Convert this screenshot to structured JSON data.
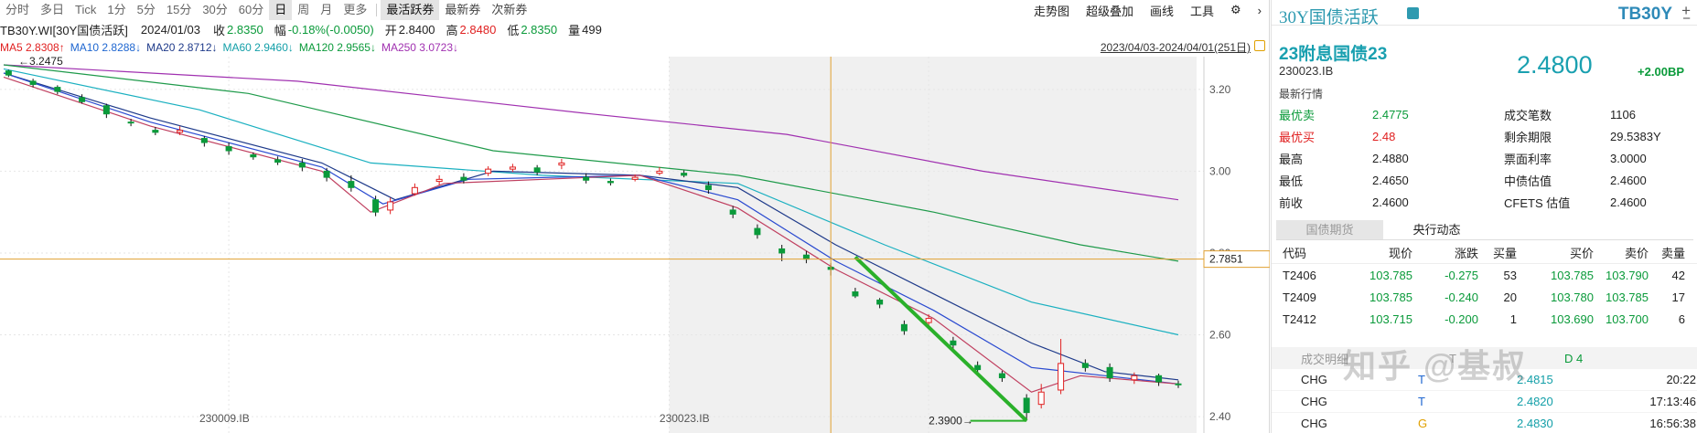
{
  "toolbar": {
    "periods": [
      "分时",
      "多日",
      "Tick",
      "1分",
      "5分",
      "15分",
      "30分",
      "60分",
      "日",
      "周",
      "月",
      "更多"
    ],
    "active_period": "日",
    "bonds": [
      "最活跃券",
      "最新券",
      "次新券"
    ],
    "active_bond": "最活跃券",
    "tools": [
      "走势图",
      "超级叠加",
      "画线",
      "工具"
    ]
  },
  "info": {
    "symbol": "TB30Y.WI[30Y国债活跃]",
    "date": "2024/01/03",
    "close_label": "收",
    "close": "2.8350",
    "amp_label": "幅",
    "amp": "-0.18%(-0.0050)",
    "open_label": "开",
    "open": "2.8400",
    "high_label": "高",
    "high": "2.8480",
    "low_label": "低",
    "low": "2.8350",
    "vol_label": "量",
    "vol": "499"
  },
  "ma": {
    "ma5": "MA5 2.8308↑",
    "ma10": "MA10 2.8288↓",
    "ma20": "MA20 2.8712↓",
    "ma60": "MA60 2.9460↓",
    "ma120": "MA120 2.9565↓",
    "ma250": "MA250 3.0723↓",
    "range": "2023/04/03-2024/04/01(251日)"
  },
  "chart_data": {
    "type": "candlestick",
    "y_ticks": [
      "3.20",
      "3.00",
      "2.80",
      "2.60",
      "2.40"
    ],
    "ylim": [
      2.36,
      3.28
    ],
    "price_line": "2.7851",
    "annotations": {
      "start_high": "3.2475",
      "low": "2.3900"
    },
    "x_labels": [
      "230009.IB",
      "230023.IB"
    ],
    "close_path": [
      [
        0,
        3.24
      ],
      [
        10,
        3.22
      ],
      [
        20,
        3.2
      ],
      [
        30,
        3.18
      ],
      [
        40,
        3.16
      ],
      [
        50,
        3.12
      ],
      [
        60,
        3.1
      ],
      [
        70,
        3.1
      ],
      [
        80,
        3.08
      ],
      [
        90,
        3.06
      ],
      [
        100,
        3.04
      ],
      [
        110,
        3.03
      ],
      [
        120,
        3.02
      ],
      [
        130,
        3.0
      ],
      [
        140,
        2.98
      ],
      [
        150,
        2.9
      ],
      [
        160,
        2.91
      ],
      [
        170,
        2.96
      ],
      [
        180,
        2.98
      ],
      [
        190,
        2.98
      ],
      [
        200,
        3.0
      ],
      [
        210,
        3.01
      ],
      [
        220,
        3.0
      ],
      [
        230,
        3.02
      ],
      [
        240,
        2.98
      ],
      [
        250,
        2.97
      ],
      [
        260,
        2.98
      ],
      [
        270,
        3.0
      ],
      [
        280,
        2.99
      ],
      [
        290,
        2.96
      ],
      [
        300,
        2.9
      ],
      [
        310,
        2.85
      ],
      [
        320,
        2.8
      ],
      [
        330,
        2.79
      ],
      [
        340,
        2.76
      ],
      [
        350,
        2.7
      ],
      [
        360,
        2.68
      ],
      [
        370,
        2.62
      ],
      [
        380,
        2.63
      ],
      [
        390,
        2.58
      ],
      [
        400,
        2.52
      ],
      [
        410,
        2.5
      ],
      [
        420,
        2.44
      ],
      [
        430,
        2.46
      ],
      [
        440,
        2.53
      ],
      [
        450,
        2.52
      ],
      [
        460,
        2.49
      ],
      [
        470,
        2.5
      ],
      [
        480,
        2.48
      ]
    ],
    "series": [
      {
        "name": "MA250",
        "color": "#a030b0",
        "points": [
          [
            0,
            3.26
          ],
          [
            120,
            3.22
          ],
          [
            240,
            3.14
          ],
          [
            320,
            3.09
          ],
          [
            400,
            3.0
          ],
          [
            480,
            2.93
          ]
        ]
      },
      {
        "name": "MA120",
        "color": "#1e9a4a",
        "points": [
          [
            0,
            3.26
          ],
          [
            100,
            3.19
          ],
          [
            200,
            3.05
          ],
          [
            300,
            2.99
          ],
          [
            380,
            2.9
          ],
          [
            440,
            2.82
          ],
          [
            480,
            2.78
          ]
        ]
      },
      {
        "name": "MA60",
        "color": "#1ab0c0",
        "points": [
          [
            0,
            3.25
          ],
          [
            80,
            3.15
          ],
          [
            150,
            3.02
          ],
          [
            220,
            2.99
          ],
          [
            300,
            2.97
          ],
          [
            360,
            2.82
          ],
          [
            420,
            2.68
          ],
          [
            480,
            2.6
          ]
        ]
      },
      {
        "name": "MA20",
        "color": "#1e3a8a",
        "points": [
          [
            0,
            3.24
          ],
          [
            60,
            3.13
          ],
          [
            130,
            3.02
          ],
          [
            160,
            2.93
          ],
          [
            200,
            3.0
          ],
          [
            260,
            2.99
          ],
          [
            300,
            2.96
          ],
          [
            340,
            2.82
          ],
          [
            380,
            2.7
          ],
          [
            420,
            2.58
          ],
          [
            450,
            2.51
          ],
          [
            480,
            2.49
          ]
        ]
      },
      {
        "name": "MA10",
        "color": "#2a4ad0",
        "points": [
          [
            0,
            3.24
          ],
          [
            60,
            3.12
          ],
          [
            130,
            3.01
          ],
          [
            155,
            2.92
          ],
          [
            190,
            2.98
          ],
          [
            260,
            2.99
          ],
          [
            300,
            2.93
          ],
          [
            340,
            2.78
          ],
          [
            380,
            2.66
          ],
          [
            420,
            2.52
          ],
          [
            450,
            2.5
          ],
          [
            480,
            2.48
          ]
        ]
      },
      {
        "name": "MA5",
        "color": "#c04060",
        "points": [
          [
            0,
            3.23
          ],
          [
            60,
            3.11
          ],
          [
            130,
            3.0
          ],
          [
            150,
            2.9
          ],
          [
            180,
            2.97
          ],
          [
            260,
            2.99
          ],
          [
            300,
            2.91
          ],
          [
            340,
            2.76
          ],
          [
            380,
            2.64
          ],
          [
            420,
            2.46
          ],
          [
            440,
            2.5
          ],
          [
            480,
            2.48
          ]
        ]
      }
    ],
    "candles": [
      [
        2,
        3.245,
        3.235,
        3.248,
        3.23
      ],
      [
        12,
        3.22,
        3.212,
        3.226,
        3.205
      ],
      [
        22,
        3.205,
        3.195,
        3.21,
        3.188
      ],
      [
        32,
        3.18,
        3.17,
        3.188,
        3.165
      ],
      [
        42,
        3.16,
        3.14,
        3.165,
        3.13
      ],
      [
        52,
        3.12,
        3.118,
        3.128,
        3.11
      ],
      [
        62,
        3.1,
        3.095,
        3.108,
        3.088
      ],
      [
        72,
        3.095,
        3.1,
        3.11,
        3.088
      ],
      [
        82,
        3.08,
        3.07,
        3.086,
        3.06
      ],
      [
        92,
        3.06,
        3.05,
        3.07,
        3.04
      ],
      [
        102,
        3.04,
        3.035,
        3.046,
        3.028
      ],
      [
        112,
        3.028,
        3.022,
        3.036,
        3.015
      ],
      [
        122,
        3.02,
        3.01,
        3.03,
        3.0
      ],
      [
        132,
        3.0,
        2.985,
        3.008,
        2.975
      ],
      [
        142,
        2.975,
        2.96,
        2.99,
        2.95
      ],
      [
        152,
        2.93,
        2.9,
        2.94,
        2.89
      ],
      [
        158,
        2.905,
        2.925,
        2.935,
        2.895
      ],
      [
        168,
        2.945,
        2.96,
        2.97,
        2.94
      ],
      [
        178,
        2.975,
        2.98,
        2.99,
        2.965
      ],
      [
        188,
        2.985,
        2.978,
        2.995,
        2.97
      ],
      [
        198,
        2.995,
        3.005,
        3.012,
        2.988
      ],
      [
        208,
        3.005,
        3.01,
        3.018,
        2.998
      ],
      [
        218,
        3.008,
        2.998,
        3.015,
        2.99
      ],
      [
        228,
        3.015,
        3.02,
        3.03,
        3.005
      ],
      [
        238,
        2.985,
        2.978,
        2.995,
        2.97
      ],
      [
        248,
        2.975,
        2.972,
        2.982,
        2.965
      ],
      [
        258,
        2.98,
        2.985,
        2.992,
        2.975
      ],
      [
        268,
        2.995,
        3.0,
        3.01,
        2.99
      ],
      [
        278,
        2.995,
        2.99,
        3.002,
        2.985
      ],
      [
        288,
        2.965,
        2.955,
        2.975,
        2.945
      ],
      [
        298,
        2.905,
        2.895,
        2.915,
        2.885
      ],
      [
        308,
        2.86,
        2.845,
        2.87,
        2.835
      ],
      [
        318,
        2.81,
        2.8,
        2.82,
        2.78
      ],
      [
        328,
        2.795,
        2.785,
        2.805,
        2.775
      ],
      [
        338,
        2.765,
        2.76,
        2.775,
        2.745
      ],
      [
        348,
        2.705,
        2.695,
        2.715,
        2.69
      ],
      [
        358,
        2.685,
        2.675,
        2.69,
        2.665
      ],
      [
        368,
        2.625,
        2.61,
        2.635,
        2.6
      ],
      [
        378,
        2.63,
        2.64,
        2.65,
        2.62
      ],
      [
        388,
        2.585,
        2.575,
        2.595,
        2.565
      ],
      [
        398,
        2.525,
        2.515,
        2.535,
        2.5
      ],
      [
        408,
        2.505,
        2.495,
        2.512,
        2.485
      ],
      [
        418,
        2.445,
        2.41,
        2.455,
        2.39
      ],
      [
        424,
        2.43,
        2.46,
        2.48,
        2.42
      ],
      [
        432,
        2.465,
        2.53,
        2.59,
        2.455
      ],
      [
        442,
        2.53,
        2.52,
        2.54,
        2.51
      ],
      [
        452,
        2.52,
        2.495,
        2.53,
        2.485
      ],
      [
        462,
        2.49,
        2.5,
        2.508,
        2.48
      ],
      [
        472,
        2.5,
        2.485,
        2.505,
        2.475
      ],
      [
        480,
        2.48,
        2.478,
        2.488,
        2.47
      ]
    ]
  },
  "panel": {
    "title": "30Y国债活跃",
    "code": "TB30Y",
    "bond_name": "23附息国债23",
    "bond_id": "230023.IB",
    "price": "2.4800",
    "change": "+2.00BP",
    "section": "最新行情",
    "quotes": [
      [
        "最优卖",
        "2.4775",
        "成交笔数",
        "1106"
      ],
      [
        "最优买",
        "2.48",
        "剩余期限",
        "29.5383Y"
      ],
      [
        "最高",
        "2.4880",
        "票面利率",
        "3.0000"
      ],
      [
        "最低",
        "2.4650",
        "中债估值",
        "2.4600"
      ],
      [
        "前收",
        "2.4600",
        "CFETS 估值",
        "2.4600"
      ]
    ],
    "tabs": [
      "国债期货",
      "央行动态"
    ],
    "futures_header": [
      "代码",
      "现价",
      "涨跌",
      "买量",
      "买价",
      "卖价",
      "卖量"
    ],
    "futures": [
      [
        "T2406",
        "103.785",
        "-0.275",
        "53",
        "103.785",
        "103.790",
        "42"
      ],
      [
        "T2409",
        "103.785",
        "-0.240",
        "20",
        "103.780",
        "103.785",
        "17"
      ],
      [
        "T2412",
        "103.715",
        "-0.200",
        "1",
        "103.690",
        "103.700",
        "6"
      ]
    ],
    "trades_header": [
      "成交明细",
      "T",
      "D 4"
    ],
    "trades": [
      [
        "CHG",
        "T",
        "2.4815",
        "20:22"
      ],
      [
        "CHG",
        "T",
        "2.4820",
        "17:13:46"
      ],
      [
        "CHG",
        "G",
        "2.4830",
        "16:56:38"
      ]
    ]
  },
  "watermark": "知乎 @基叔"
}
